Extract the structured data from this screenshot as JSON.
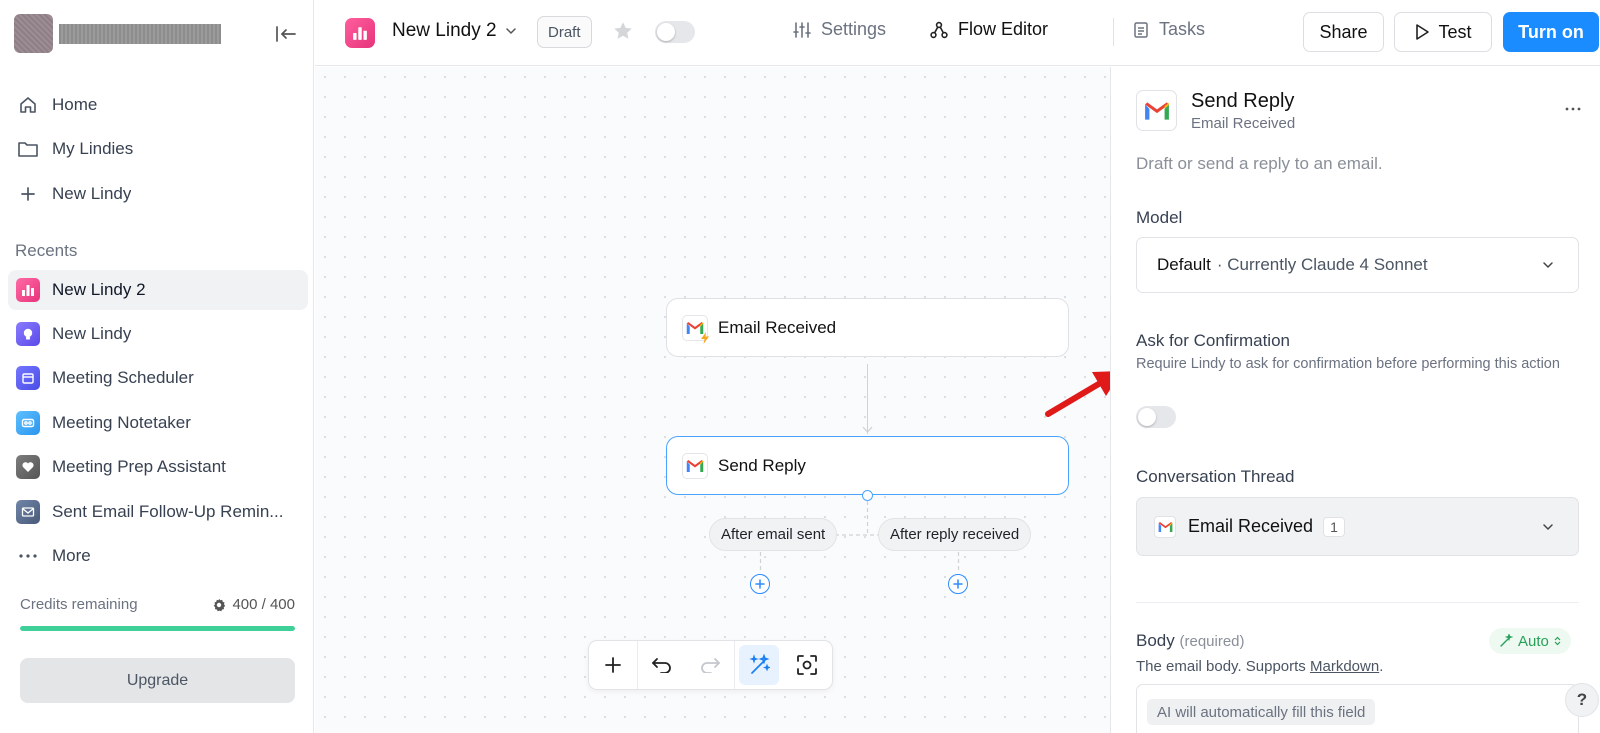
{
  "sidebar": {
    "nav": [
      {
        "label": "Home",
        "icon": "home-icon"
      },
      {
        "label": "My Lindies",
        "icon": "folder-icon"
      },
      {
        "label": "New Lindy",
        "icon": "plus-icon"
      }
    ],
    "recents_title": "Recents",
    "recents": [
      {
        "label": "New Lindy 2",
        "icon": "bar-chart-icon",
        "color": "#ff4f93",
        "active": true
      },
      {
        "label": "New Lindy",
        "icon": "lightbulb-icon",
        "color": "#6a5cf6"
      },
      {
        "label": "Meeting Scheduler",
        "icon": "calendar-icon",
        "color": "#5b5ef4"
      },
      {
        "label": "Meeting Notetaker",
        "icon": "voicemail-icon",
        "color": "#3fa9f5"
      },
      {
        "label": "Meeting Prep Assistant",
        "icon": "heart-icon",
        "color": "#6b6b6b"
      },
      {
        "label": "Sent Email Follow-Up Remin...",
        "icon": "mail-icon",
        "color": "#5a6b8c"
      }
    ],
    "more_label": "More",
    "credits": {
      "label": "Credits remaining",
      "value": "400 / 400",
      "fraction": 1.0
    },
    "upgrade_label": "Upgrade"
  },
  "header": {
    "title": "New Lindy 2",
    "status": "Draft",
    "settings_label": "Settings",
    "flow_editor_label": "Flow Editor",
    "tasks_label": "Tasks",
    "share_label": "Share",
    "test_label": "Test",
    "turn_on_label": "Turn on",
    "accent": "#1a8cff"
  },
  "canvas": {
    "nodes": [
      {
        "label": "Email Received",
        "icon": "gmail-trigger-icon"
      },
      {
        "label": "Send Reply",
        "icon": "gmail-icon",
        "selected": true
      }
    ],
    "branches": [
      "After email sent",
      "After reply received"
    ]
  },
  "panel": {
    "title": "Send Reply",
    "subtitle": "Email Received",
    "description": "Draft or send a reply to an email.",
    "model_label": "Model",
    "model_value": "Default",
    "model_detail": "· Currently Claude 4 Sonnet",
    "confirm_label": "Ask for Confirmation",
    "confirm_help": "Require Lindy to ask for confirmation before performing this action",
    "confirm_enabled": false,
    "thread_label": "Conversation Thread",
    "thread_value": "Email Received",
    "thread_count": "1",
    "body_label": "Body",
    "body_required": "(required)",
    "body_help_prefix": "The email body. Supports ",
    "body_help_link": "Markdown",
    "body_help_suffix": ".",
    "auto_label": "Auto",
    "ai_fill": "AI will automatically fill this field"
  },
  "help_label": "?"
}
